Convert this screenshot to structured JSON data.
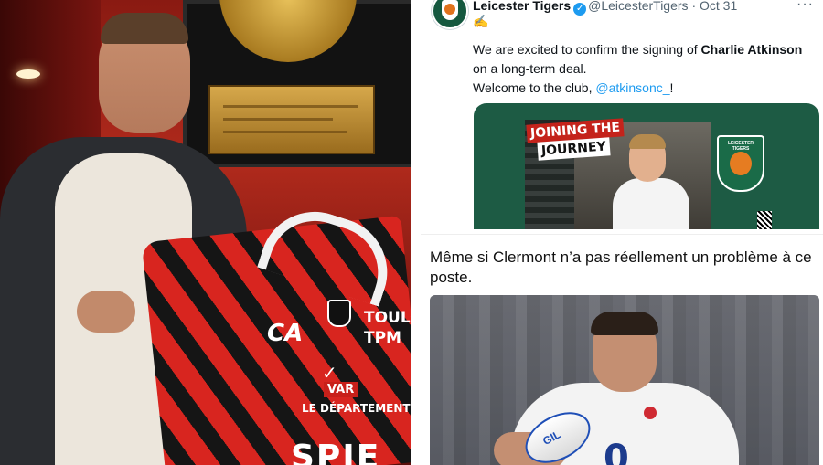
{
  "left_photo": {
    "jersey_text": {
      "ca": "CA",
      "toulon": "TOULO",
      "tpm": "TPM",
      "var": "VAR",
      "departement": "LE DÉPARTEMENT",
      "spie": "SPIE",
      "nike": "✓"
    }
  },
  "tweet": {
    "display_name": "Leicester Tigers",
    "handle": "@LeicesterTigers",
    "separator": "·",
    "date": "Oct 31",
    "more": "···",
    "emoji": "✍",
    "body_prefix": "We are excited to confirm the signing of ",
    "body_bold": "Charlie Atkinson",
    "body_suffix": " on a long-term deal.",
    "welcome_prefix": "Welcome to the club, ",
    "welcome_mention": "@atkinsonc_",
    "welcome_suffix": "!",
    "media": {
      "banner_line1": "JOINING THE",
      "banner_line2": "JOURNEY",
      "badge_text": "LEICESTER TIGERS"
    }
  },
  "caption": "Même si Clermont n’a pas réellement un problème à ce poste.",
  "right_photo": {
    "shirt_number": "0",
    "ball_text": "GIL"
  },
  "colors": {
    "twitter_blue": "#1d9bf0",
    "tigers_green": "#1d5b44",
    "toulon_red": "#d8251f"
  }
}
